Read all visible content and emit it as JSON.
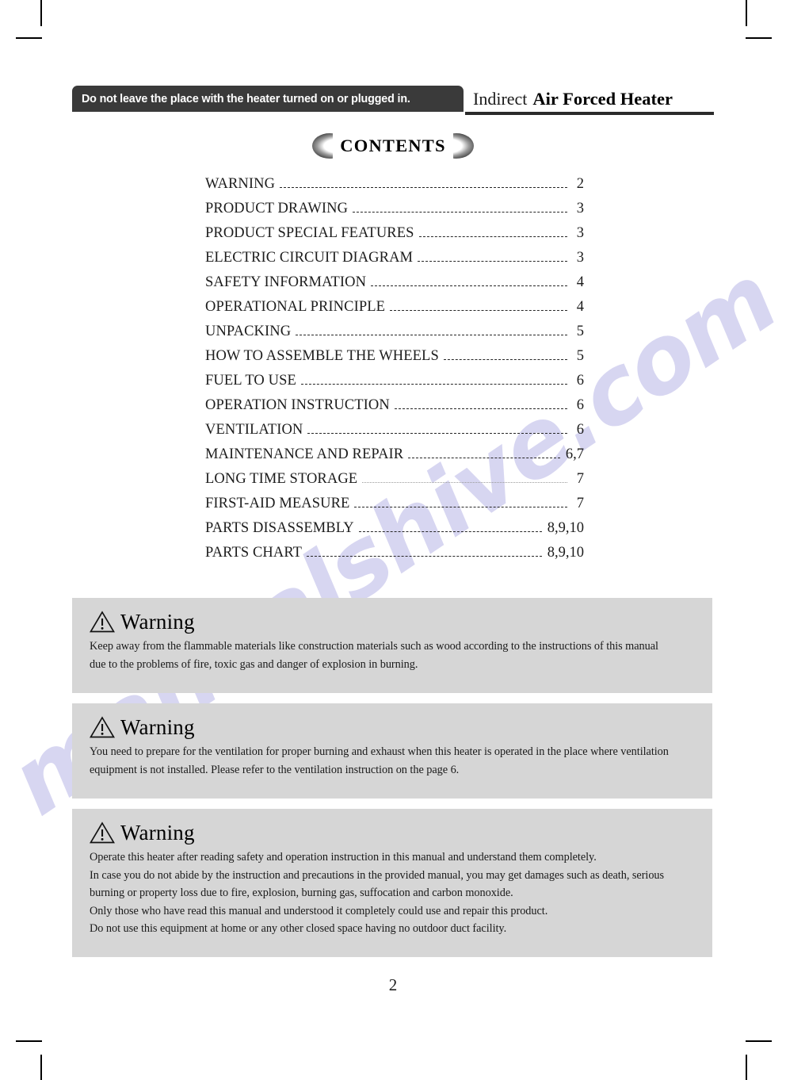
{
  "header": {
    "warning_bar_text": "Do not leave the place with the heater turned on or plugged in.",
    "title_light": "Indirect",
    "title_bold": "Air Forced Heater"
  },
  "contents": {
    "heading": "CONTENTS",
    "items": [
      {
        "label": "WARNING",
        "page": "2"
      },
      {
        "label": "PRODUCT DRAWING",
        "page": "3"
      },
      {
        "label": "PRODUCT SPECIAL FEATURES",
        "page": "3"
      },
      {
        "label": "ELECTRIC CIRCUIT DIAGRAM",
        "page": "3"
      },
      {
        "label": "SAFETY INFORMATION",
        "page": "4"
      },
      {
        "label": "OPERATIONAL PRINCIPLE",
        "page": "4"
      },
      {
        "label": "UNPACKING",
        "page": "5"
      },
      {
        "label": "HOW TO ASSEMBLE THE WHEELS",
        "page": "5"
      },
      {
        "label": "FUEL TO USE",
        "page": "6"
      },
      {
        "label": "OPERATION INSTRUCTION",
        "page": "6"
      },
      {
        "label": "VENTILATION",
        "page": "6"
      },
      {
        "label": "MAINTENANCE AND REPAIR",
        "page": "6,7"
      },
      {
        "label": "LONG TIME STORAGE",
        "page": "7"
      },
      {
        "label": "FIRST-AID MEASURE",
        "page": "7"
      },
      {
        "label": "PARTS DISASSEMBLY",
        "page": "8,9,10"
      },
      {
        "label": "PARTS CHART",
        "page": "8,9,10"
      }
    ]
  },
  "warnings": [
    {
      "heading": "Warning",
      "lines": [
        "Keep away from the flammable materials like construction materials such as wood according to the instructions of this manual",
        "due to the problems of fire, toxic gas and danger of explosion in burning."
      ]
    },
    {
      "heading": "Warning",
      "lines": [
        "You need to prepare for the ventilation for proper burning and exhaust when this heater is operated in the place where ventilation",
        "equipment is not installed. Please refer to the ventilation instruction on the page 6."
      ]
    },
    {
      "heading": "Warning",
      "lines": [
        "Operate this heater after reading safety and operation instruction in this manual and understand them completely.",
        "In case you do not abide by the instruction and precautions in the provided manual, you may get damages such as death, serious",
        "burning or property loss due to fire, explosion, burning gas, suffocation and carbon monoxide.",
        "Only those who have read this manual and understood it completely could use and repair this product.",
        "Do not use this equipment at home or any other closed space having no outdoor duct facility."
      ]
    }
  ],
  "footer": {
    "page_number": "2"
  },
  "watermark": {
    "text": "manualshive.com"
  },
  "colors": {
    "warning_bar_background": "#3a3a3a",
    "warning_box_background": "#d6d6d6",
    "watermark": "#c9c7ec",
    "text": "#1a1a1a"
  }
}
